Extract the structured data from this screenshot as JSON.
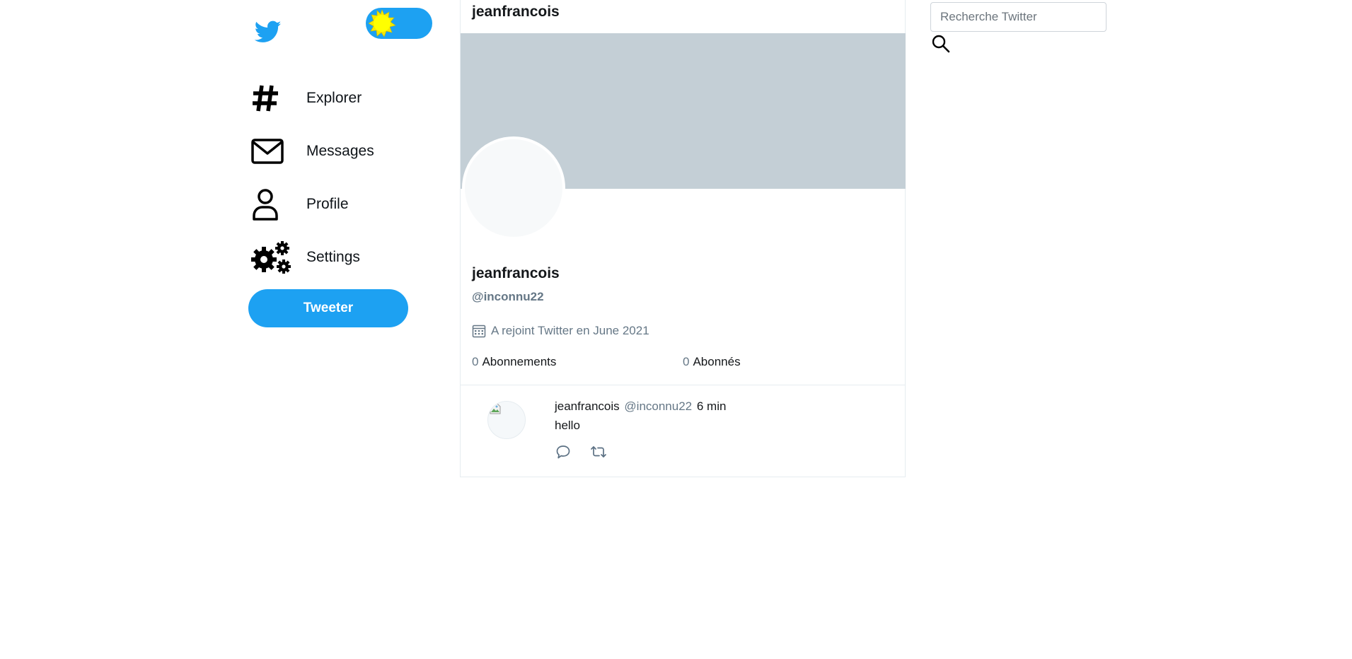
{
  "sidebar": {
    "logo_icon": "twitter-bird-icon",
    "theme_toggle_icon": "sun-icon",
    "items": [
      {
        "label": "Explorer",
        "icon": "hashtag-icon"
      },
      {
        "label": "Messages",
        "icon": "envelope-icon"
      },
      {
        "label": "Profile",
        "icon": "user-icon"
      },
      {
        "label": "Settings",
        "icon": "gears-icon"
      }
    ],
    "tweet_button_label": "Tweeter"
  },
  "main": {
    "title": "jeanfrancois",
    "profile": {
      "name": "jeanfrancois",
      "handle": "@inconnu22",
      "joined": "A rejoint Twitter en June 2021",
      "following_count": "0",
      "following_label": "Abonnements",
      "followers_count": "0",
      "followers_label": "Abonnés"
    },
    "tweets": [
      {
        "name": "jeanfrancois",
        "handle": "@inconnu22",
        "time": "6 min",
        "text": "hello"
      }
    ]
  },
  "search": {
    "placeholder": "Recherche Twitter"
  },
  "colors": {
    "accent": "#1da1f2",
    "banner": "#c4cfd6",
    "muted_text": "#657786"
  }
}
